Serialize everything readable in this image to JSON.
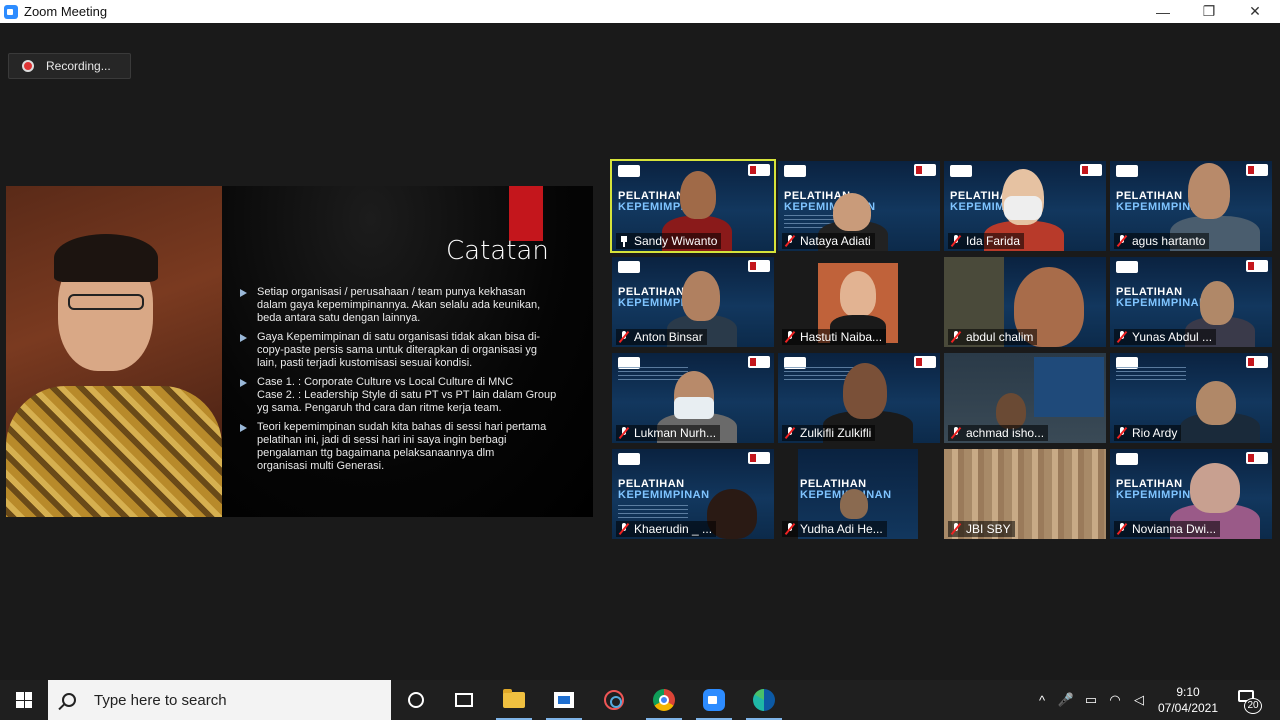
{
  "window": {
    "title": "Zoom Meeting",
    "minimize": "—",
    "maximize": "❐",
    "close": "✕"
  },
  "recording": {
    "label": "Recording..."
  },
  "slide": {
    "heading": "Catatan",
    "bullets": [
      [
        "Setiap organisasi / perusahaan / team punya kekhasan",
        "dalam gaya kepemimpinannya. Akan selalu ada keunikan,",
        "beda antara satu dengan lainnya."
      ],
      [
        "Gaya Kepemimpinan di satu organisasi tidak akan bisa di-",
        "copy-paste persis sama untuk diterapkan di organisasi yg",
        "lain, pasti terjadi kustomisasi sesuai kondisi."
      ],
      [
        "Case 1. : Corporate Culture vs Local Culture di MNC",
        "Case 2. : Leadership Style di satu PT vs PT lain dalam Group",
        "yg sama. Pengaruh thd cara dan ritme kerja team."
      ],
      [
        "Teori kepemimpinan sudah kita bahas di sessi hari pertama",
        "pelatihan ini, jadi di sessi hari ini saya ingin berbagi",
        "pengalaman ttg bagaimana pelaksanaannya dlm",
        "organisasi multi Generasi."
      ]
    ]
  },
  "banner": {
    "line1": "PELATIHAN",
    "line2": "KEPEMIMPINAN"
  },
  "participants": [
    {
      "name": "Sandy Wiwanto",
      "status": "pinned"
    },
    {
      "name": "Nataya Adiati",
      "status": "muted"
    },
    {
      "name": "Ida Farida",
      "status": "muted"
    },
    {
      "name": "agus hartanto",
      "status": "muted"
    },
    {
      "name": "Anton Binsar",
      "status": "muted"
    },
    {
      "name": "Hastuti Naiba...",
      "status": "muted"
    },
    {
      "name": "abdul chalim",
      "status": "muted"
    },
    {
      "name": "Yunas Abdul ...",
      "status": "muted"
    },
    {
      "name": "Lukman Nurh...",
      "status": "muted"
    },
    {
      "name": "Zulkifli Zulkifli",
      "status": "muted"
    },
    {
      "name": "achmad isho...",
      "status": "muted"
    },
    {
      "name": "Rio Ardy",
      "status": "muted"
    },
    {
      "name": "Khaerudin _ ...",
      "status": "muted"
    },
    {
      "name": "Yudha Adi He...",
      "status": "muted"
    },
    {
      "name": "JBI SBY",
      "status": "muted"
    },
    {
      "name": "Novianna Dwi...",
      "status": "muted"
    }
  ],
  "taskbar": {
    "search_placeholder": "Type here to search",
    "time": "9:10",
    "date": "07/04/2021",
    "notification_count": "20"
  }
}
